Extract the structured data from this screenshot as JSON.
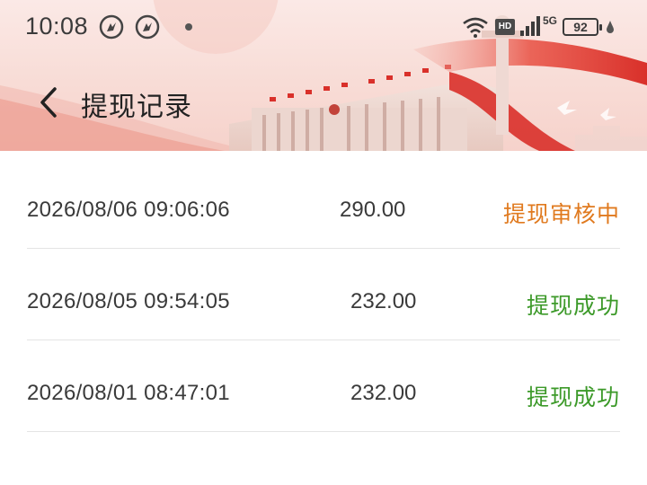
{
  "status_bar": {
    "time": "10:08",
    "battery_level": "92",
    "network": "5G",
    "hd_label": "HD",
    "icons": [
      "app-notification-icon",
      "app-notification-icon",
      "wifi-icon",
      "signal-icon",
      "battery-icon"
    ]
  },
  "header": {
    "title": "提现记录",
    "back_icon": "chevron-left-icon"
  },
  "records": [
    {
      "time": "2026/08/06 09:06:06",
      "amount": "290.00",
      "status": "提现审核中",
      "status_type": "pending"
    },
    {
      "time": "2026/08/05 09:54:05",
      "amount": "232.00",
      "status": "提现成功",
      "status_type": "success"
    },
    {
      "time": "2026/08/01 08:47:01",
      "amount": "232.00",
      "status": "提现成功",
      "status_type": "success"
    }
  ],
  "colors": {
    "pending": "#e07a1f",
    "success": "#3d9a2a",
    "banner_red": "#d9302a"
  }
}
